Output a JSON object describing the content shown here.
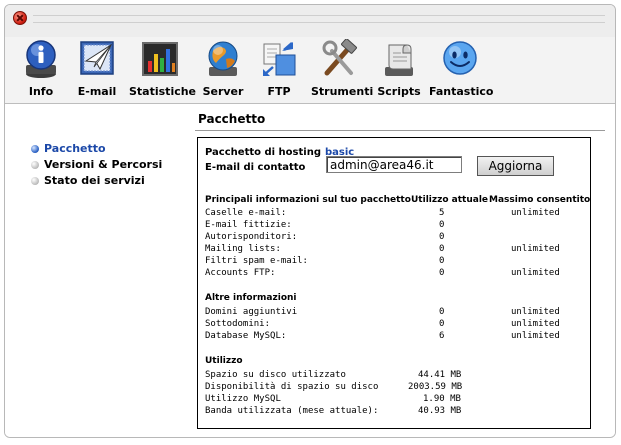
{
  "toolbar": {
    "items": [
      {
        "label": "Info",
        "icon": "info-icon"
      },
      {
        "label": "E-mail",
        "icon": "email-icon"
      },
      {
        "label": "Statistiche",
        "icon": "statistics-icon"
      },
      {
        "label": "Server",
        "icon": "server-icon"
      },
      {
        "label": "FTP",
        "icon": "ftp-icon"
      },
      {
        "label": "Strumenti",
        "icon": "tools-icon"
      },
      {
        "label": "Scripts",
        "icon": "scripts-icon"
      },
      {
        "label": "Fantastico",
        "icon": "fantastico-icon"
      }
    ]
  },
  "page": {
    "title": "Pacchetto"
  },
  "sidebar": {
    "items": [
      {
        "label": "Pacchetto",
        "active": true
      },
      {
        "label": "Versioni & Percorsi",
        "active": false
      },
      {
        "label": "Stato dei servizi",
        "active": false
      }
    ]
  },
  "package": {
    "hosting_label": "Pacchetto di hosting",
    "hosting_value": "basic",
    "email_label": "E-mail di contatto",
    "email_value": "admin@area46.it",
    "update_button": "Aggiorna"
  },
  "main_info": {
    "heading": "Principali informazioni sul tuo pacchetto",
    "col_usage": "Utilizzo attuale",
    "col_max": "Massimo consentito",
    "rows": [
      {
        "label": "Caselle e-mail:",
        "usage": "5",
        "max": "unlimited"
      },
      {
        "label": "E-mail fittizie:",
        "usage": "0",
        "max": ""
      },
      {
        "label": "Autorisponditori:",
        "usage": "0",
        "max": ""
      },
      {
        "label": "Mailing lists:",
        "usage": "0",
        "max": "unlimited"
      },
      {
        "label": "Filtri spam e-mail:",
        "usage": "0",
        "max": ""
      },
      {
        "label": "Accounts FTP:",
        "usage": "0",
        "max": "unlimited"
      }
    ]
  },
  "other_info": {
    "heading": "Altre informazioni",
    "rows": [
      {
        "label": "Domini aggiuntivi",
        "usage": "0",
        "max": "unlimited"
      },
      {
        "label": "Sottodomini:",
        "usage": "0",
        "max": "unlimited"
      },
      {
        "label": "Database MySQL:",
        "usage": "6",
        "max": "unlimited"
      }
    ]
  },
  "usage": {
    "heading": "Utilizzo",
    "rows": [
      {
        "label": "Spazio su disco utilizzato",
        "value": "44.41 MB"
      },
      {
        "label": "Disponibilità di spazio su disco",
        "value": "2003.59 MB"
      },
      {
        "label": "Utilizzo MySQL",
        "value": "1.90 MB"
      },
      {
        "label": "Banda utilizzata (mese attuale):",
        "value": "40.93 MB"
      }
    ]
  },
  "colors": {
    "accent": "#1b48a8",
    "close": "#d21e10"
  }
}
